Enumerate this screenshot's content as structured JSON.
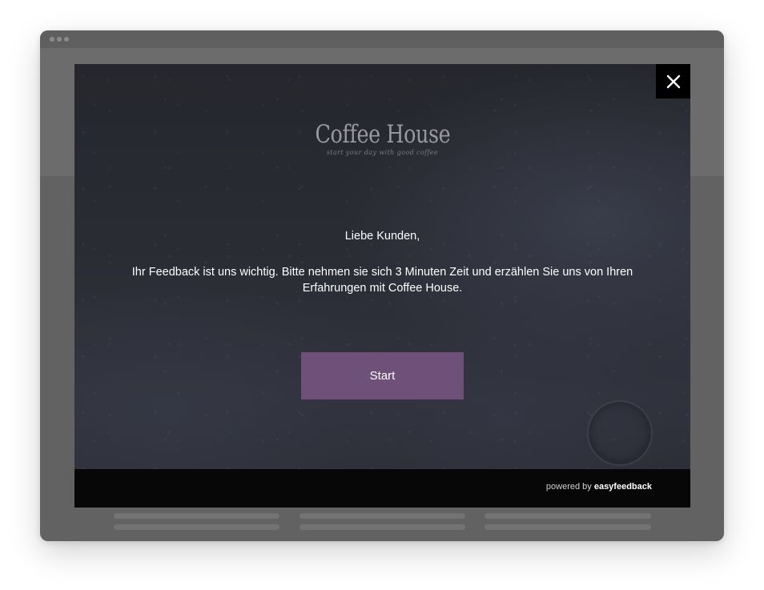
{
  "modal": {
    "logo_title": "Coffee House",
    "logo_tagline": "start your day with good coffee",
    "greeting": "Liebe Kunden,",
    "message_line1": "Ihr Feedback ist uns wichtig. Bitte nehmen sie sich 3 Minuten Zeit und erzählen Sie uns von Ihren",
    "message_line2": "Erfahrungen mit Coffee House.",
    "start_label": "Start",
    "close_icon": "close-icon",
    "footer": {
      "powered_prefix": "powered by",
      "powered_brand": "easyfeedback"
    }
  },
  "colors": {
    "accent_button": "#6f5078",
    "modal_background": "#2a2c34",
    "footer_background": "#070707",
    "close_background": "#000000",
    "overlay": "#626262"
  }
}
